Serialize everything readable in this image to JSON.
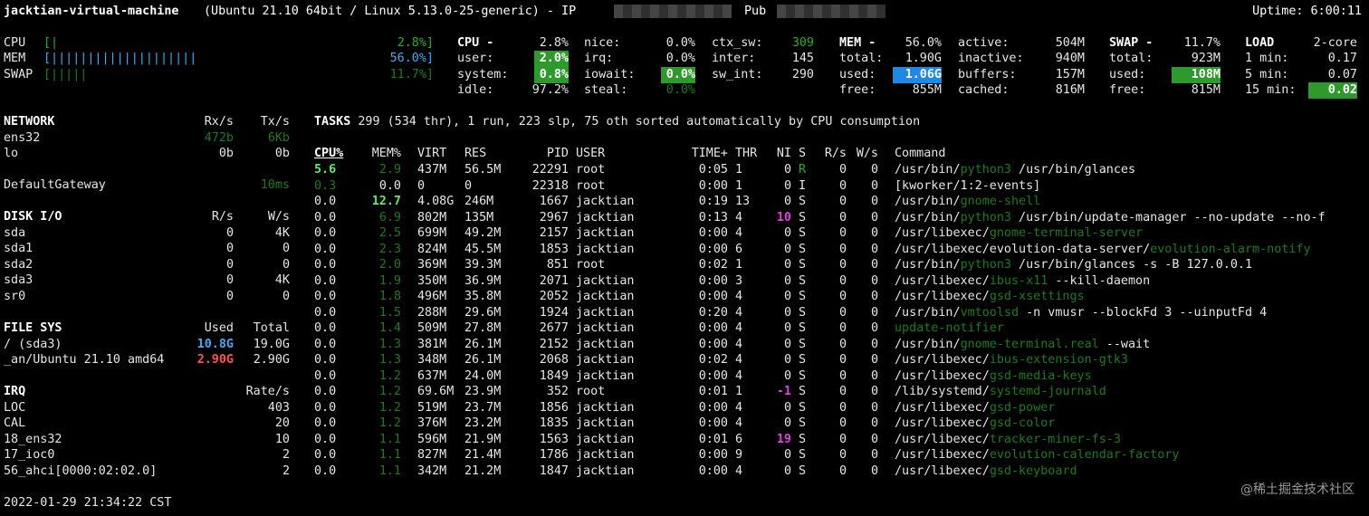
{
  "header": {
    "host": "jacktian-virtual-machine",
    "os": "(Ubuntu 21.10 64bit / Linux 5.13.0-25-generic) - IP",
    "pub": "Pub",
    "uptime": "Uptime: 6:00:11"
  },
  "quicklook": {
    "cpu": {
      "label": "CPU",
      "bar": "[|",
      "pct": "2.8%]"
    },
    "mem": {
      "label": "MEM",
      "bar": "[||||||||||||||||||||",
      "pct": "56.0%]"
    },
    "swap": {
      "label": "SWAP",
      "bar": "[|||||",
      "pct": "11.7%]"
    }
  },
  "cpu": {
    "title": "CPU -",
    "total": "2.8%",
    "user_l": "user:",
    "user": "2.0%",
    "system_l": "system:",
    "system": "0.8%",
    "idle_l": "idle:",
    "idle": "97.2%",
    "nice_l": "nice:",
    "nice": "0.0%",
    "irq_l": "irq:",
    "irq": "0.0%",
    "iowait_l": "iowait:",
    "iowait": "0.0%",
    "steal_l": "steal:",
    "steal": "0.0%",
    "ctx_l": "ctx_sw:",
    "ctx": "309",
    "inter_l": "inter:",
    "inter": "145",
    "swint_l": "sw_int:",
    "swint": "290"
  },
  "mem": {
    "title": "MEM -",
    "pct": "56.0%",
    "total_l": "total:",
    "total": "1.90G",
    "used_l": "used:",
    "used": "1.06G",
    "free_l": "free:",
    "free": "855M",
    "active_l": "active:",
    "active": "504M",
    "inactive_l": "inactive:",
    "inactive": "940M",
    "buffers_l": "buffers:",
    "buffers": "157M",
    "cached_l": "cached:",
    "cached": "816M"
  },
  "swap": {
    "title": "SWAP -",
    "pct": "11.7%",
    "total_l": "total:",
    "total": "923M",
    "used_l": "used:",
    "used": "108M",
    "free_l": "free:",
    "free": "815M"
  },
  "load": {
    "title": "LOAD",
    "cores": "2-core",
    "m1_l": "1 min:",
    "m1": "0.17",
    "m5_l": "5 min:",
    "m5": "0.07",
    "m15_l": "15 min:",
    "m15": "0.02"
  },
  "network": {
    "title": "NETWORK",
    "rx_h": "Rx/s",
    "tx_h": "Tx/s",
    "rows": [
      {
        "name": "ens32",
        "rx": "472b",
        "tx": "6Kb"
      },
      {
        "name": "lo",
        "rx": "0b",
        "tx": "0b"
      }
    ],
    "gw_name": "DefaultGateway",
    "gw_val": "10ms"
  },
  "disk": {
    "title": "DISK I/O",
    "r_h": "R/s",
    "w_h": "W/s",
    "rows": [
      {
        "name": "sda",
        "r": "0",
        "w": "4K"
      },
      {
        "name": "sda1",
        "r": "0",
        "w": "0"
      },
      {
        "name": "sda2",
        "r": "0",
        "w": "0"
      },
      {
        "name": "sda3",
        "r": "0",
        "w": "4K"
      },
      {
        "name": "sr0",
        "r": "0",
        "w": "0"
      }
    ]
  },
  "fs": {
    "title": "FILE SYS",
    "used_h": "Used",
    "total_h": "Total",
    "rows": [
      {
        "name": "/ (sda3)",
        "used": "10.8G",
        "total": "19.0G"
      },
      {
        "name": "_an/Ubuntu 21.10 amd64",
        "used": "2.90G",
        "total": "2.90G"
      }
    ]
  },
  "irq": {
    "title": "IRQ",
    "rate_h": "Rate/s",
    "rows": [
      {
        "name": "LOC",
        "rate": "403"
      },
      {
        "name": "CAL",
        "rate": "20"
      },
      {
        "name": "18_ens32",
        "rate": "10"
      },
      {
        "name": "17_ioc0",
        "rate": "2"
      },
      {
        "name": "56_ahci[0000:02:02.0]",
        "rate": "2"
      }
    ]
  },
  "tasks": {
    "label": "TASKS",
    "summary": "299 (534 thr), 1 run, 223 slp, 75 oth sorted automatically by CPU consumption"
  },
  "proc_headers": {
    "cpu": "CPU%",
    "mem": "MEM%",
    "virt": "VIRT",
    "res": "RES",
    "pid": "PID",
    "user": "USER",
    "time": "TIME+",
    "thr": "THR",
    "ni": "NI",
    "s": "S",
    "rs": "R/s",
    "ws": "W/s",
    "cmd": "Command"
  },
  "procs": [
    {
      "cpu": "5.6",
      "mem": "2.9",
      "virt": "437M",
      "res": "56.5M",
      "pid": "22291",
      "user": "root",
      "time": "0:05",
      "thr": "1",
      "ni": "0",
      "s": "R",
      "rs": "0",
      "ws": "0",
      "c1": "/usr/bin/",
      "c2": "python3",
      "c3": " /usr/bin/glances"
    },
    {
      "cpu": "0.3",
      "mem": "0.0",
      "virt": "0",
      "res": "0",
      "pid": "22318",
      "user": "root",
      "time": "0:00",
      "thr": "1",
      "ni": "0",
      "s": "I",
      "rs": "0",
      "ws": "0",
      "c1": "[kworker/1:2-events]",
      "c2": "",
      "c3": ""
    },
    {
      "cpu": "0.0",
      "mem": "12.7",
      "virt": "4.08G",
      "res": "246M",
      "pid": "1667",
      "user": "jacktian",
      "time": "0:19",
      "thr": "13",
      "ni": "0",
      "s": "S",
      "rs": "0",
      "ws": "0",
      "c1": "/usr/bin/",
      "c2": "gnome-shell",
      "c3": ""
    },
    {
      "cpu": "0.0",
      "mem": "6.9",
      "virt": "802M",
      "res": "135M",
      "pid": "2967",
      "user": "jacktian",
      "time": "0:13",
      "thr": "4",
      "ni": "10",
      "s": "S",
      "rs": "0",
      "ws": "0",
      "c1": "/usr/bin/",
      "c2": "python3",
      "c3": " /usr/bin/update-manager --no-update --no-f"
    },
    {
      "cpu": "0.0",
      "mem": "2.5",
      "virt": "699M",
      "res": "49.2M",
      "pid": "2157",
      "user": "jacktian",
      "time": "0:00",
      "thr": "4",
      "ni": "0",
      "s": "S",
      "rs": "0",
      "ws": "0",
      "c1": "/usr/libexec/",
      "c2": "gnome-terminal-server",
      "c3": ""
    },
    {
      "cpu": "0.0",
      "mem": "2.3",
      "virt": "824M",
      "res": "45.5M",
      "pid": "1853",
      "user": "jacktian",
      "time": "0:00",
      "thr": "6",
      "ni": "0",
      "s": "S",
      "rs": "0",
      "ws": "0",
      "c1": "/usr/libexec/evolution-data-server/",
      "c2": "evolution-alarm-notify",
      "c3": ""
    },
    {
      "cpu": "0.0",
      "mem": "2.0",
      "virt": "369M",
      "res": "39.3M",
      "pid": "851",
      "user": "root",
      "time": "0:02",
      "thr": "1",
      "ni": "0",
      "s": "S",
      "rs": "0",
      "ws": "0",
      "c1": "/usr/bin/",
      "c2": "python3",
      "c3": " /usr/bin/glances -s -B 127.0.0.1"
    },
    {
      "cpu": "0.0",
      "mem": "1.9",
      "virt": "350M",
      "res": "36.9M",
      "pid": "2071",
      "user": "jacktian",
      "time": "0:00",
      "thr": "3",
      "ni": "0",
      "s": "S",
      "rs": "0",
      "ws": "0",
      "c1": "/usr/libexec/",
      "c2": "ibus-x11",
      "c3": " --kill-daemon"
    },
    {
      "cpu": "0.0",
      "mem": "1.8",
      "virt": "496M",
      "res": "35.8M",
      "pid": "2052",
      "user": "jacktian",
      "time": "0:00",
      "thr": "4",
      "ni": "0",
      "s": "S",
      "rs": "0",
      "ws": "0",
      "c1": "/usr/libexec/",
      "c2": "gsd-xsettings",
      "c3": ""
    },
    {
      "cpu": "0.0",
      "mem": "1.5",
      "virt": "288M",
      "res": "29.6M",
      "pid": "1924",
      "user": "jacktian",
      "time": "0:20",
      "thr": "4",
      "ni": "0",
      "s": "S",
      "rs": "0",
      "ws": "0",
      "c1": "/usr/bin/",
      "c2": "vmtoolsd",
      "c3": " -n vmusr --blockFd 3 --uinputFd 4"
    },
    {
      "cpu": "0.0",
      "mem": "1.4",
      "virt": "509M",
      "res": "27.8M",
      "pid": "2677",
      "user": "jacktian",
      "time": "0:00",
      "thr": "4",
      "ni": "0",
      "s": "S",
      "rs": "0",
      "ws": "0",
      "c1": "",
      "c2": "update-notifier",
      "c3": ""
    },
    {
      "cpu": "0.0",
      "mem": "1.3",
      "virt": "381M",
      "res": "26.1M",
      "pid": "2152",
      "user": "jacktian",
      "time": "0:00",
      "thr": "4",
      "ni": "0",
      "s": "S",
      "rs": "0",
      "ws": "0",
      "c1": "/usr/bin/",
      "c2": "gnome-terminal.real",
      "c3": " --wait"
    },
    {
      "cpu": "0.0",
      "mem": "1.3",
      "virt": "348M",
      "res": "26.1M",
      "pid": "2068",
      "user": "jacktian",
      "time": "0:02",
      "thr": "4",
      "ni": "0",
      "s": "S",
      "rs": "0",
      "ws": "0",
      "c1": "/usr/libexec/",
      "c2": "ibus-extension-gtk3",
      "c3": ""
    },
    {
      "cpu": "0.0",
      "mem": "1.2",
      "virt": "637M",
      "res": "24.0M",
      "pid": "1849",
      "user": "jacktian",
      "time": "0:00",
      "thr": "4",
      "ni": "0",
      "s": "S",
      "rs": "0",
      "ws": "0",
      "c1": "/usr/libexec/",
      "c2": "gsd-media-keys",
      "c3": ""
    },
    {
      "cpu": "0.0",
      "mem": "1.2",
      "virt": "69.6M",
      "res": "23.9M",
      "pid": "352",
      "user": "root",
      "time": "0:01",
      "thr": "1",
      "ni": "-1",
      "s": "S",
      "rs": "0",
      "ws": "0",
      "c1": "/lib/systemd/",
      "c2": "systemd-journald",
      "c3": ""
    },
    {
      "cpu": "0.0",
      "mem": "1.2",
      "virt": "519M",
      "res": "23.7M",
      "pid": "1856",
      "user": "jacktian",
      "time": "0:00",
      "thr": "4",
      "ni": "0",
      "s": "S",
      "rs": "0",
      "ws": "0",
      "c1": "/usr/libexec/",
      "c2": "gsd-power",
      "c3": ""
    },
    {
      "cpu": "0.0",
      "mem": "1.2",
      "virt": "376M",
      "res": "23.2M",
      "pid": "1835",
      "user": "jacktian",
      "time": "0:00",
      "thr": "4",
      "ni": "0",
      "s": "S",
      "rs": "0",
      "ws": "0",
      "c1": "/usr/libexec/",
      "c2": "gsd-color",
      "c3": ""
    },
    {
      "cpu": "0.0",
      "mem": "1.1",
      "virt": "596M",
      "res": "21.9M",
      "pid": "1563",
      "user": "jacktian",
      "time": "0:01",
      "thr": "6",
      "ni": "19",
      "s": "S",
      "rs": "0",
      "ws": "0",
      "c1": "/usr/libexec/",
      "c2": "tracker-miner-fs-3",
      "c3": ""
    },
    {
      "cpu": "0.0",
      "mem": "1.1",
      "virt": "827M",
      "res": "21.4M",
      "pid": "1786",
      "user": "jacktian",
      "time": "0:00",
      "thr": "9",
      "ni": "0",
      "s": "S",
      "rs": "0",
      "ws": "0",
      "c1": "/usr/libexec/",
      "c2": "evolution-calendar-factory",
      "c3": ""
    },
    {
      "cpu": "0.0",
      "mem": "1.1",
      "virt": "342M",
      "res": "21.2M",
      "pid": "1847",
      "user": "jacktian",
      "time": "0:00",
      "thr": "4",
      "ni": "0",
      "s": "S",
      "rs": "0",
      "ws": "0",
      "c1": "/usr/libexec/",
      "c2": "gsd-keyboard",
      "c3": ""
    }
  ],
  "footer": {
    "datetime": "2022-01-29 21:34:22 CST",
    "watermark": "@稀土掘金技术社区"
  },
  "colors": {
    "background": "#000000",
    "green": "#2fae2f",
    "highlight_green": "#2e9a2e",
    "highlight_blue": "#1e88e5",
    "blue": "#4aa9f0",
    "red": "#ff5555",
    "magenta": "#e040e0"
  }
}
